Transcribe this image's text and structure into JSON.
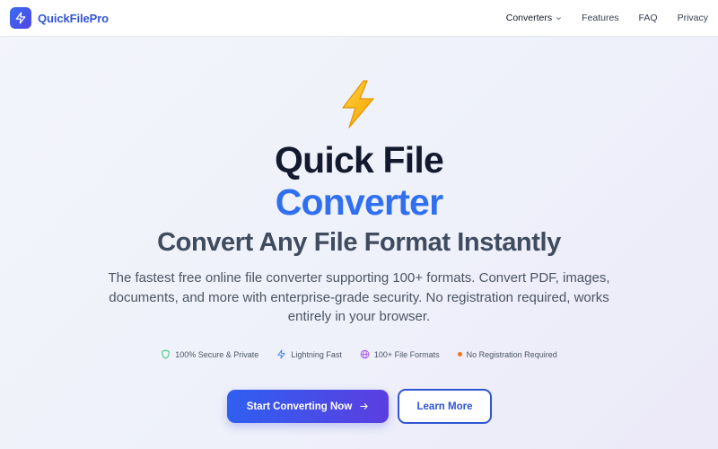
{
  "brand": {
    "name": "QuickFilePro",
    "color": "#2f55d4"
  },
  "nav": {
    "converters": "Converters",
    "features": "Features",
    "faq": "FAQ",
    "privacy": "Privacy"
  },
  "hero": {
    "title_line1": "Quick File",
    "title_line2": "Converter",
    "subtitle": "Convert Any File Format Instantly",
    "description": "The fastest free online file converter supporting 100+ formats. Convert PDF, images, documents, and more with enterprise-grade security. No registration required, works entirely in your browser.",
    "features": [
      {
        "icon": "shield-icon",
        "label": "100% Secure & Private",
        "color": "#22c55e"
      },
      {
        "icon": "lightning-icon",
        "label": "Lightning Fast",
        "color": "#3b82f6"
      },
      {
        "icon": "globe-icon",
        "label": "100+ File Formats",
        "color": "#a855f7"
      },
      {
        "icon": "dot-icon",
        "label": "No Registration Required",
        "color": "#f97316"
      }
    ],
    "primary_button": "Start Converting Now",
    "secondary_button": "Learn More"
  },
  "colors": {
    "accent_blue": "#2f6ff0",
    "heading_dark": "#141a2e",
    "subtitle_gray": "#3f4b5e"
  }
}
